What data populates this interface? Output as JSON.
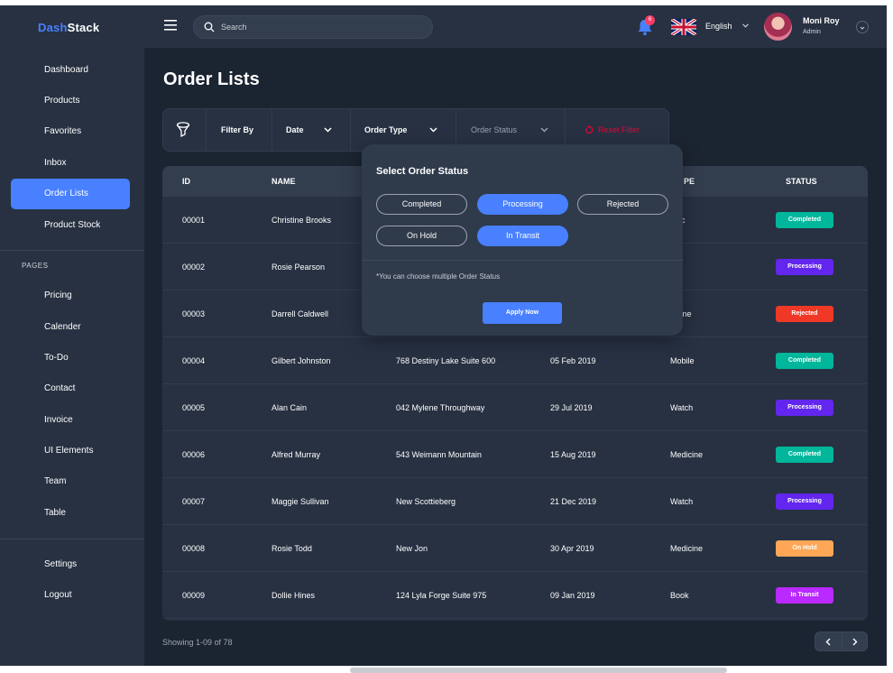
{
  "colors": {
    "accent": "#4880ff",
    "completed": "#00b69b",
    "processing": "#6226ef",
    "rejected": "#ef3826",
    "on_hold": "#ffa756",
    "in_transit": "#ba29ff",
    "reset": "#ea0234"
  },
  "brand": {
    "part1": "Dash",
    "part2": "Stack"
  },
  "sidebar": {
    "items": [
      {
        "label": "Dashboard"
      },
      {
        "label": "Products"
      },
      {
        "label": "Favorites"
      },
      {
        "label": "Inbox"
      },
      {
        "label": "Order Lists",
        "active": true
      },
      {
        "label": "Product Stock"
      }
    ],
    "section_label": "PAGES",
    "pages": [
      {
        "label": "Pricing"
      },
      {
        "label": "Calender"
      },
      {
        "label": "To-Do"
      },
      {
        "label": "Contact"
      },
      {
        "label": "Invoice"
      },
      {
        "label": "UI Elements"
      },
      {
        "label": "Team"
      },
      {
        "label": "Table"
      }
    ],
    "bottom": [
      {
        "label": "Settings"
      },
      {
        "label": "Logout"
      }
    ]
  },
  "topbar": {
    "search_placeholder": "Search",
    "notification_count": "6",
    "language": "English",
    "user_name": "Moni Roy",
    "user_role": "Admin",
    "icons": [
      "menu-icon",
      "search-icon",
      "bell-icon",
      "uk-flag-icon",
      "chevron-down-icon"
    ]
  },
  "page": {
    "title": "Order Lists"
  },
  "filters": {
    "filter_by": "Filter By",
    "date": "Date",
    "order_type": "Order Type",
    "order_status": "Order Status",
    "reset": "Reset Filter"
  },
  "table": {
    "headers": {
      "id": "ID",
      "name": "NAME",
      "type_partial": "PE",
      "status": "STATUS"
    },
    "rows": [
      {
        "id": "00001",
        "name": "Christine Brooks",
        "address": "",
        "date": "",
        "type": "ctric",
        "status": "Completed",
        "status_key": "completed"
      },
      {
        "id": "00002",
        "name": "Rosie Pearson",
        "address": "",
        "date": "",
        "type": "ok",
        "status": "Processing",
        "status_key": "processing"
      },
      {
        "id": "00003",
        "name": "Darrell Caldwell",
        "address": "",
        "date": "",
        "type": "dicine",
        "status": "Rejected",
        "status_key": "rejected"
      },
      {
        "id": "00004",
        "name": "Gilbert Johnston",
        "address": "768 Destiny Lake Suite 600",
        "date": "05 Feb 2019",
        "type": "Mobile",
        "status": "Completed",
        "status_key": "completed"
      },
      {
        "id": "00005",
        "name": "Alan Cain",
        "address": "042 Mylene Throughway",
        "date": "29 Jul 2019",
        "type": "Watch",
        "status": "Processing",
        "status_key": "processing"
      },
      {
        "id": "00006",
        "name": "Alfred Murray",
        "address": "543 Weimann Mountain",
        "date": "15 Aug 2019",
        "type": "Medicine",
        "status": "Completed",
        "status_key": "completed"
      },
      {
        "id": "00007",
        "name": "Maggie Sullivan",
        "address": "New Scottieberg",
        "date": "21 Dec 2019",
        "type": "Watch",
        "status": "Processing",
        "status_key": "processing"
      },
      {
        "id": "00008",
        "name": "Rosie Todd",
        "address": "New Jon",
        "date": "30 Apr 2019",
        "type": "Medicine",
        "status": "On Hold",
        "status_key": "on_hold"
      },
      {
        "id": "00009",
        "name": "Dollie Hines",
        "address": "124 Lyla Forge Suite 975",
        "date": "09 Jan 2019",
        "type": "Book",
        "status": "In Transit",
        "status_key": "in_transit"
      }
    ]
  },
  "footer": {
    "showing": "Showing 1-09 of 78"
  },
  "dropdown": {
    "title": "Select Order Status",
    "options": [
      {
        "label": "Completed",
        "selected": false
      },
      {
        "label": "Processing",
        "selected": true
      },
      {
        "label": "Rejected",
        "selected": false
      },
      {
        "label": "On Hold",
        "selected": false
      },
      {
        "label": "In Transit",
        "selected": true
      }
    ],
    "note": "*You can choose multiple Order Status",
    "apply": "Apply Now"
  }
}
